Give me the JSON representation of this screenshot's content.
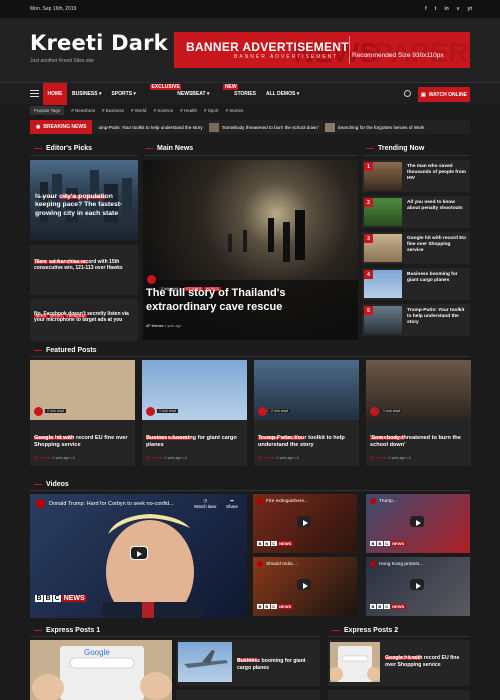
{
  "topbar": {
    "date": "Mon. Sep 16th, 2019",
    "social": [
      "f",
      "t",
      "in",
      "v",
      "yt"
    ]
  },
  "header": {
    "logo": "Kreeti Dark",
    "tagline": "Just another Kreeti Sites site"
  },
  "banner": {
    "title": "BANNER ADVERTISEMENT",
    "sub": "BANNER ADVERTISEMENT",
    "size": "Recommended Size 930x110px"
  },
  "nav": {
    "home": "HOME",
    "items": [
      "BUSINESS",
      "SPORTS",
      "NEWSBEAT",
      "STORIES",
      "ALL DEMOS"
    ],
    "badge_newsbeat": "EXCLUSIVE",
    "badge_stories": "NEW",
    "watch": "WATCH ONLINE"
  },
  "tags": {
    "label": "Popular Tags",
    "items": [
      "Newsbeat",
      "Business",
      "World",
      "Science",
      "Health",
      "Sport",
      "Stories"
    ]
  },
  "breaking": {
    "label": "BREAKING NEWS",
    "items": [
      "ump-Putin: Your toolkit to help understand the story",
      "'Somebody threatened to burn the school down'",
      "Searching for the forgotten heroes of Work"
    ]
  },
  "editors": {
    "title": "Editor's Picks",
    "feature": {
      "readtime": "1 min read",
      "tags": [
        "RESEARCH",
        "TRENDING"
      ],
      "headline": "Is your city's population keeping pace? The fastest-growing city in each state"
    },
    "list": [
      {
        "tags": [
          "NEWS",
          "WORLD",
          "TRENDING"
        ],
        "headline": "76ers set franchise record with 15th consecutive win, 121-113 over Hawks"
      },
      {
        "tags": [
          "NEWS",
          "SPORT",
          "TRENDING"
        ],
        "headline": "No, Facebook doesn't secretly listen via your microphone to target ads at you"
      }
    ]
  },
  "main": {
    "title": "Main News",
    "readtime": "2 min read",
    "tags": [
      "STORIES",
      "WORLD"
    ],
    "headline": "The full story of Thailand's extraordinary cave rescue",
    "author": "AF themes",
    "ago": "1 year ago"
  },
  "trending": {
    "title": "Trending Now",
    "items": [
      {
        "n": "1",
        "t": "The man who saved thousands of people from HIV"
      },
      {
        "n": "2",
        "t": "All you need to know about penalty shootouts"
      },
      {
        "n": "3",
        "t": "Google hit with record EU fine over Shopping service"
      },
      {
        "n": "4",
        "t": "Business booming for giant cargo planes"
      },
      {
        "n": "5",
        "t": "Trump-Putin: Your toolkit to help understand the story"
      }
    ]
  },
  "featured": {
    "title": "Featured Posts",
    "items": [
      {
        "tags": [
          "BUSINESS",
          "WORLD"
        ],
        "t": "Google hit with record EU fine over Shopping service",
        "author": "AF themes",
        "ago": "1 year ago",
        "c": "0",
        "read": "2 min read"
      },
      {
        "tags": [
          "BUSINESS",
          "NEWSBEAT"
        ],
        "t": "Business booming for giant cargo planes",
        "author": "AF themes",
        "ago": "1 year ago",
        "c": "4",
        "read": "1 min read"
      },
      {
        "tags": [
          "BUSINESS",
          "NEWSBEAT"
        ],
        "t": "Trump-Putin: Your toolkit to help understand the story",
        "author": "AF themes",
        "ago": "1 year ago",
        "c": "0",
        "read": "2 min read"
      },
      {
        "tags": [
          "NEWS",
          "STORIES"
        ],
        "t": "'Somebody threatened to burn the school down'",
        "author": "AF themes",
        "ago": "1 year ago",
        "c": "0",
        "read": "1 min read"
      }
    ]
  },
  "videos": {
    "title": "Videos",
    "main_title": "Donald Trump: Hard for Corbyn to seek no-confid...",
    "watch_later": "Watch later",
    "share": "Share",
    "bbc": [
      "B",
      "B",
      "C",
      "NEWS"
    ],
    "thumbs": [
      "Fire extinguishers...",
      "Trump...",
      "Should India ...",
      "Hong Kong protest..."
    ]
  },
  "express1": {
    "title": "Express Posts 1",
    "item": {
      "tags": [
        "BUSINESS"
      ],
      "t": "Business booming for giant cargo planes"
    }
  },
  "express2": {
    "title": "Express Posts 2",
    "item": {
      "tags": [
        "BUSINESS",
        "NEWS"
      ],
      "t": "Google hit with record EU fine over Shopping service"
    }
  }
}
